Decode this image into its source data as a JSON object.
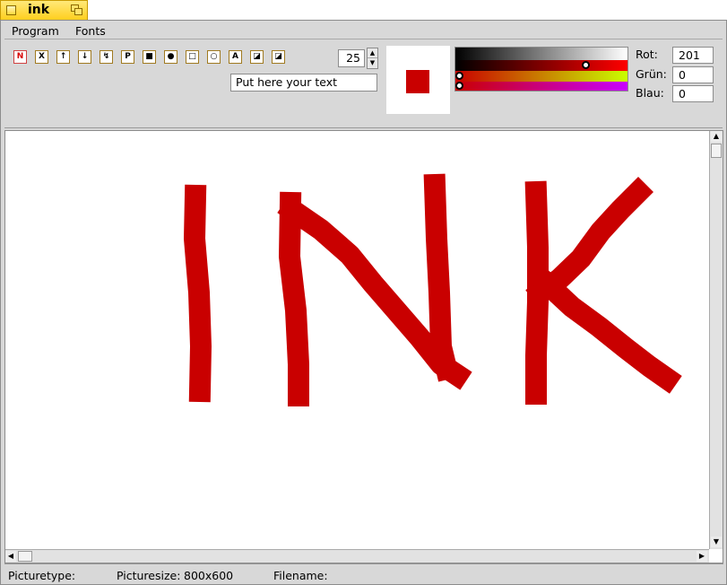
{
  "window": {
    "title": "ink",
    "close_icon": "close-box-icon",
    "zoom_icon": "zoom-box-icon"
  },
  "menu": {
    "program": "Program",
    "fonts": "Fonts"
  },
  "tools": [
    {
      "name": "tool-n-button",
      "label": "N",
      "active": true
    },
    {
      "name": "tool-x-button",
      "label": "X",
      "active": false
    },
    {
      "name": "tool-up-arrow-button",
      "label": "↑",
      "active": false
    },
    {
      "name": "tool-down-arrow-button",
      "label": "↓",
      "active": false
    },
    {
      "name": "tool-fill-button",
      "label": "↯",
      "active": false
    },
    {
      "name": "tool-p-button",
      "label": "P",
      "active": false
    },
    {
      "name": "tool-filled-rect-button",
      "label": "■",
      "active": false
    },
    {
      "name": "tool-filled-circle-button",
      "label": "●",
      "active": false
    },
    {
      "name": "tool-rect-button",
      "label": "□",
      "active": false
    },
    {
      "name": "tool-circle-button",
      "label": "○",
      "active": false
    },
    {
      "name": "tool-text-button",
      "label": "A",
      "active": false
    },
    {
      "name": "tool-eraser-1-button",
      "label": "◪",
      "active": false
    },
    {
      "name": "tool-eraser-2-button",
      "label": "◪",
      "active": false
    }
  ],
  "brush": {
    "size": "25"
  },
  "text_input": {
    "value": "Put here your text"
  },
  "color": {
    "preview_hex": "#c90000",
    "rot_label": "Rot:",
    "rot_value": "201",
    "gruen_label": "Grün:",
    "gruen_value": "0",
    "blau_label": "Blau:",
    "blau_value": "0"
  },
  "status": {
    "picturetype_label": "Picturetype:",
    "picturetype_value": "",
    "picturesize_label": "Picturesize:",
    "picturesize_value": "800x600",
    "filename_label": "Filename:",
    "filename_value": ""
  }
}
